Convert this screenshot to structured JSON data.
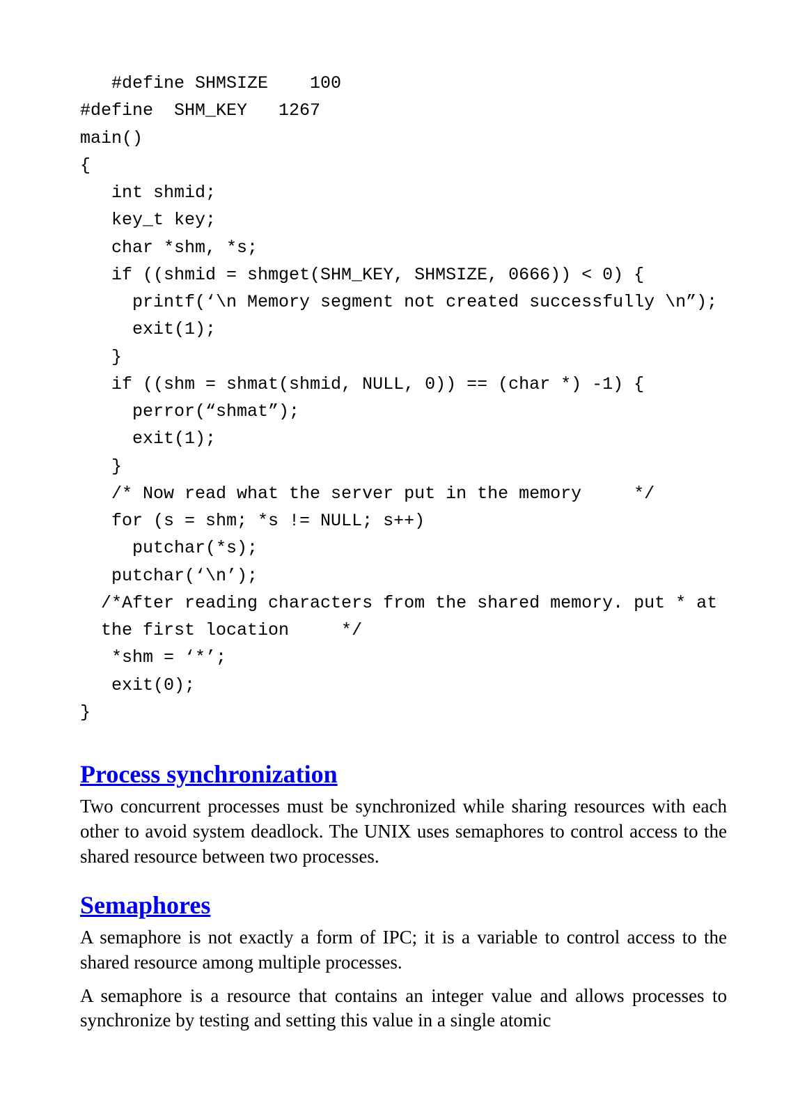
{
  "code": {
    "text": "   #define SHMSIZE    100\n#define  SHM_KEY   1267\nmain()\n{\n   int shmid;\n   key_t key;\n   char *shm, *s;\n   if ((shmid = shmget(SHM_KEY, SHMSIZE, 0666)) < 0) {\n     printf(‘\\n Memory segment not created successfully \\n”);\n     exit(1);\n   }\n   if ((shm = shmat(shmid, NULL, 0)) == (char *) -1) {\n     perror(“shmat”);\n     exit(1);\n   }\n   /* Now read what the server put in the memory     */\n   for (s = shm; *s != NULL; s++)\n     putchar(*s);\n   putchar(‘\\n’);\n  /*After reading characters from the shared memory. put * at\n  the first location     */\n   *shm = ‘*’;\n   exit(0);\n}"
  },
  "sections": [
    {
      "heading": "Process synchronization",
      "paragraphs": [
        "Two concurrent processes must be synchronized while sharing resources with each other to avoid system deadlock. The UNIX uses semaphores to control access to the shared resource between two processes."
      ]
    },
    {
      "heading": "Semaphores",
      "paragraphs": [
        "A semaphore is not exactly a form of IPC; it is a variable to control access to the shared resource among multiple processes.",
        "A semaphore is a resource that contains an integer value and allows processes to synchronize by testing and setting this value in a single atomic"
      ]
    }
  ]
}
